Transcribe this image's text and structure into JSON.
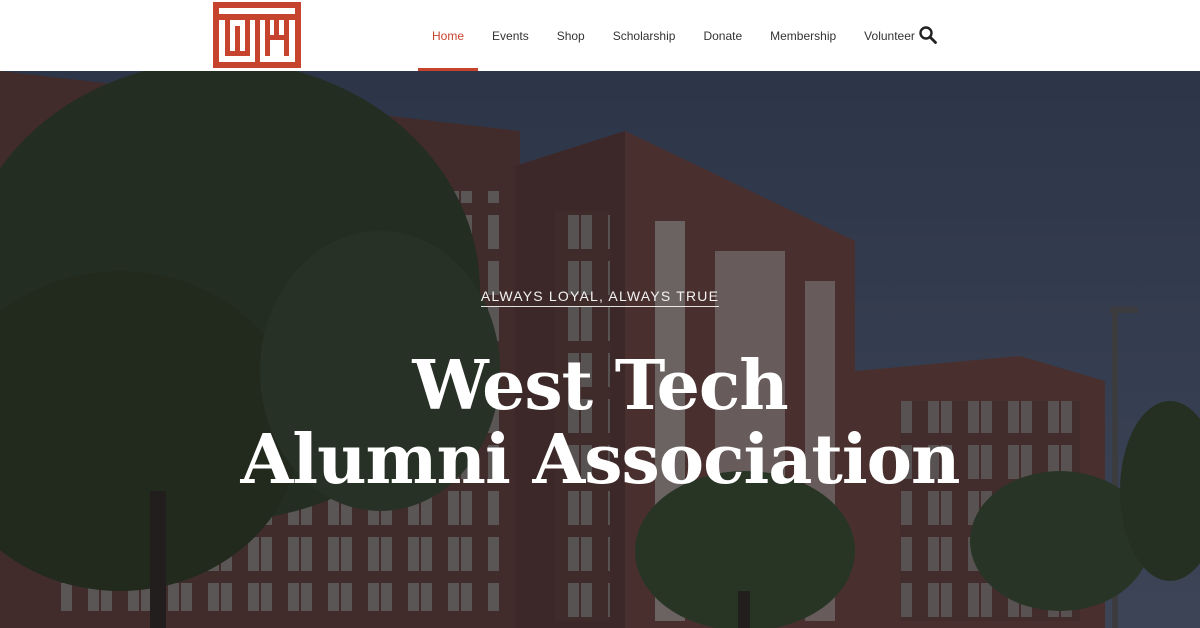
{
  "brand": {
    "logo_text": "WTA",
    "accent_color": "#c6442e"
  },
  "nav": {
    "items": [
      {
        "label": "Home",
        "active": true
      },
      {
        "label": "Events"
      },
      {
        "label": "Shop"
      },
      {
        "label": "Scholarship"
      },
      {
        "label": "Donate"
      },
      {
        "label": "Membership"
      },
      {
        "label": "Volunteer"
      }
    ],
    "search_icon": "search-icon"
  },
  "hero": {
    "tagline": "ALWAYS LOYAL, ALWAYS TRUE",
    "title_line1": "West Tech",
    "title_line2": "Alumni Association",
    "background": "school-building-photo"
  }
}
